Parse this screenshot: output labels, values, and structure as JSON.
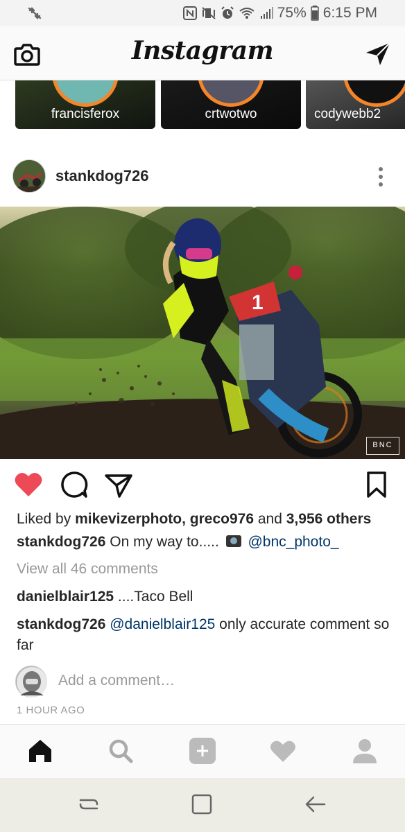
{
  "status_bar": {
    "battery": "75%",
    "time": "6:15 PM"
  },
  "header": {
    "logo": "Instagram",
    "icons": [
      "camera-icon",
      "direct-message-icon"
    ]
  },
  "stories": [
    {
      "username": "francisferox"
    },
    {
      "username": "crtwotwo"
    },
    {
      "username": "codywebb2"
    }
  ],
  "post": {
    "username": "stankdog726",
    "image_watermark": "BNC",
    "liked_by_prefix": "Liked by",
    "liked_by_user1": "mikevizerphoto,",
    "liked_by_user2": "greco976",
    "liked_by_and": "and",
    "liked_by_others": "3,956 others",
    "caption_user": "stankdog726",
    "caption_text": "On my way to.....",
    "caption_mention": "@bnc_photo_",
    "view_all_comments": "View all 46 comments",
    "comments": [
      {
        "user": "danielblair125",
        "text": "....Taco Bell"
      },
      {
        "user": "stankdog726",
        "mention": "@danielblair125",
        "text": "only accurate comment so far"
      }
    ],
    "add_comment_placeholder": "Add a comment…",
    "timestamp": "1 HOUR AGO"
  },
  "tabbar": {
    "tabs": [
      "home-tab",
      "search-tab",
      "add-post-tab",
      "activity-tab",
      "profile-tab"
    ]
  },
  "colors": {
    "like_red": "#ed4956",
    "mention_blue": "#003569",
    "muted_gray": "#999999",
    "story_ring": "#f58529"
  }
}
